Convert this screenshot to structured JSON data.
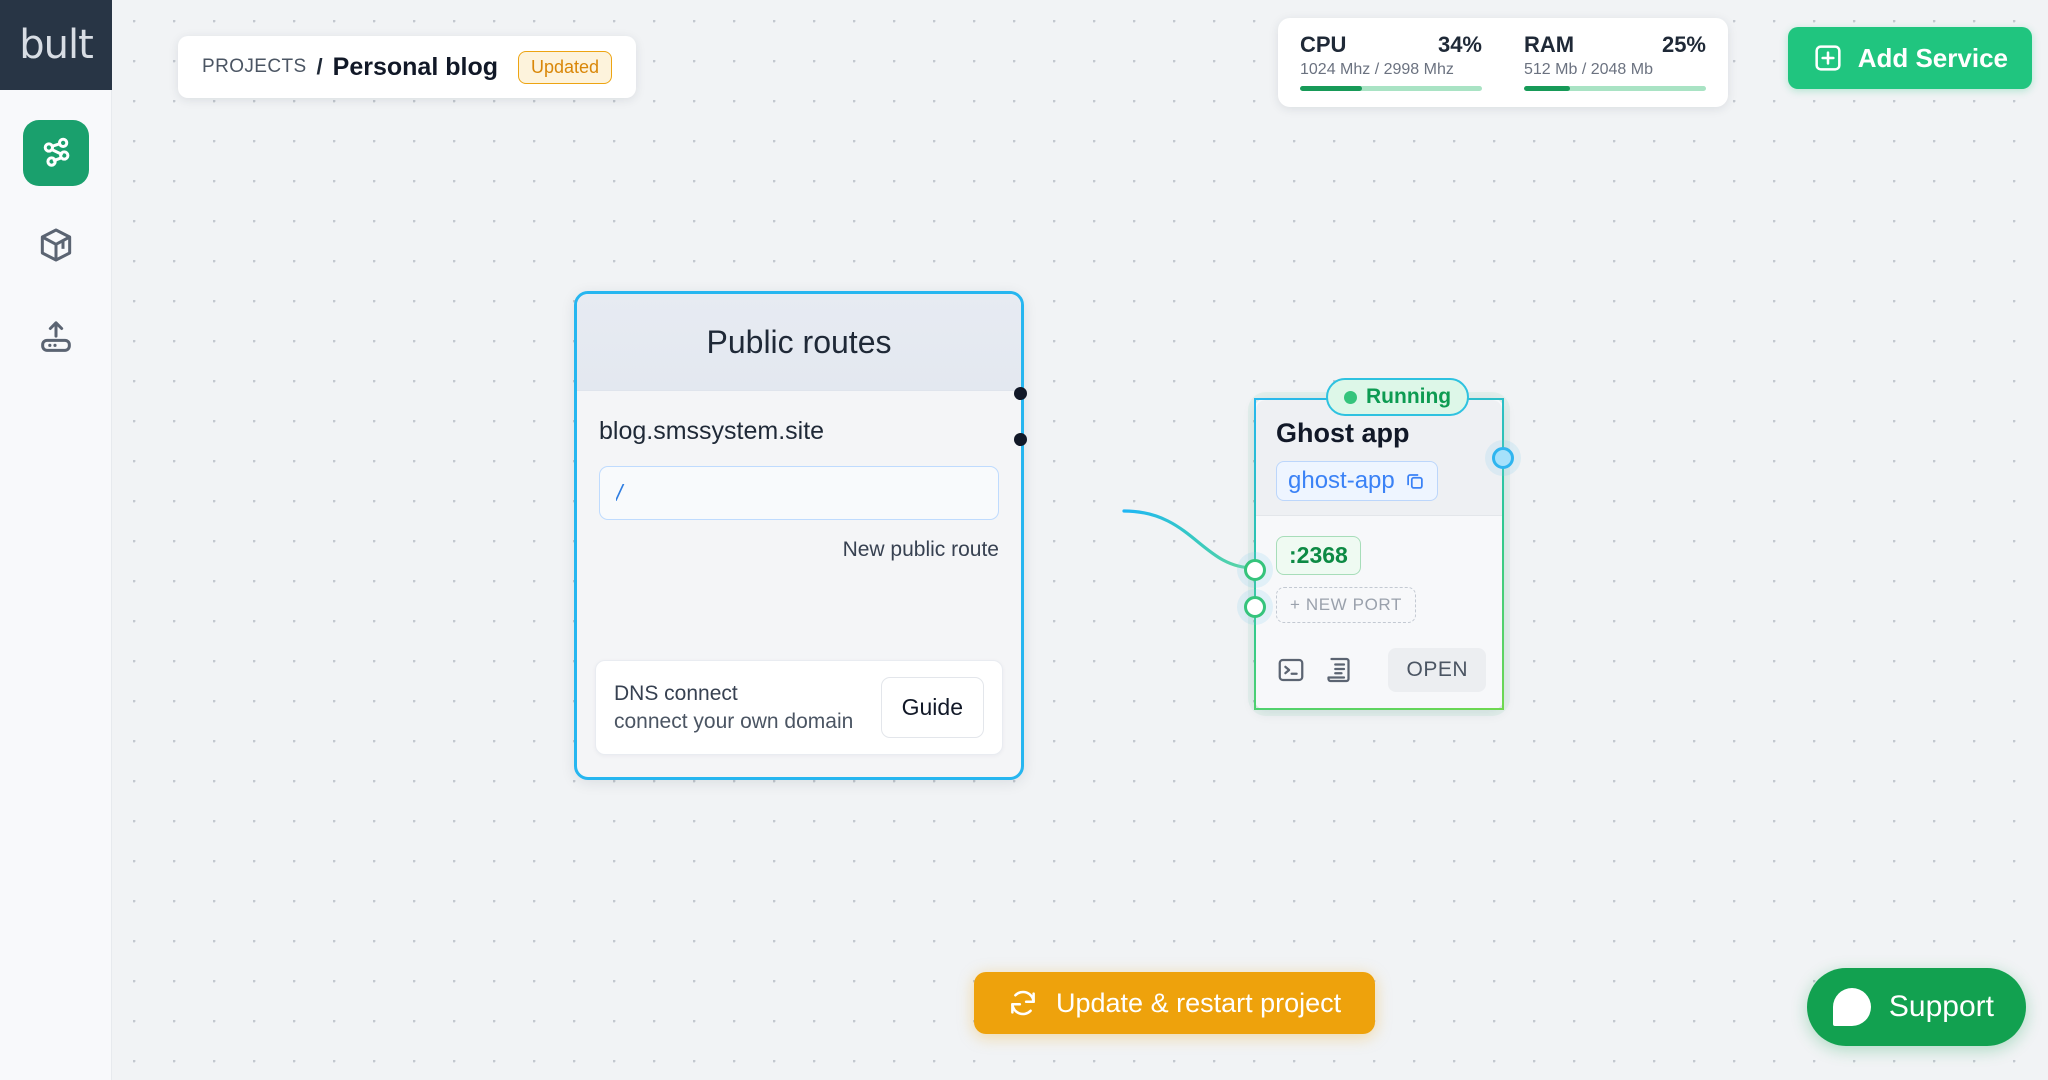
{
  "app": {
    "logo": "bult"
  },
  "sidebar": {
    "items": [
      {
        "name": "project-graph",
        "icon": "network-icon",
        "active": true
      },
      {
        "name": "containers",
        "icon": "container-icon",
        "active": false
      },
      {
        "name": "deploy",
        "icon": "deploy-upload-icon",
        "active": false
      }
    ]
  },
  "breadcrumb": {
    "root": "PROJECTS",
    "separator": "/",
    "title": "Personal blog",
    "badge": "Updated"
  },
  "stats": [
    {
      "label": "CPU",
      "percent": "34%",
      "detail": "1024 Mhz / 2998 Mhz",
      "value": 34
    },
    {
      "label": "RAM",
      "percent": "25%",
      "detail": "512 Mb / 2048 Mb",
      "value": 25
    }
  ],
  "header": {
    "add_service_label": "Add Service"
  },
  "routes_node": {
    "title": "Public routes",
    "domain": "blog.smssystem.site",
    "route_value": "/",
    "route_placeholder": "/",
    "new_route_label": "New public route",
    "dns": {
      "title": "DNS connect",
      "subtitle": "connect your own domain",
      "guide_label": "Guide"
    }
  },
  "ghost_node": {
    "status": "Running",
    "title": "Ghost app",
    "slug": "ghost-app",
    "port": ":2368",
    "new_port_label": "+ NEW PORT",
    "open_label": "OPEN",
    "terminal_icon": "terminal-icon",
    "logs_icon": "logs-icon",
    "copy_icon": "copy-icon"
  },
  "footer": {
    "update_label": "Update & restart project",
    "support_label": "Support"
  },
  "colors": {
    "accent_green": "#20c57f",
    "node_blue": "#26b6f0",
    "node_green": "#35c47c",
    "warning_orange": "#eea20c",
    "badge_orange": "#d98708",
    "link_blue": "#3b82f6"
  }
}
